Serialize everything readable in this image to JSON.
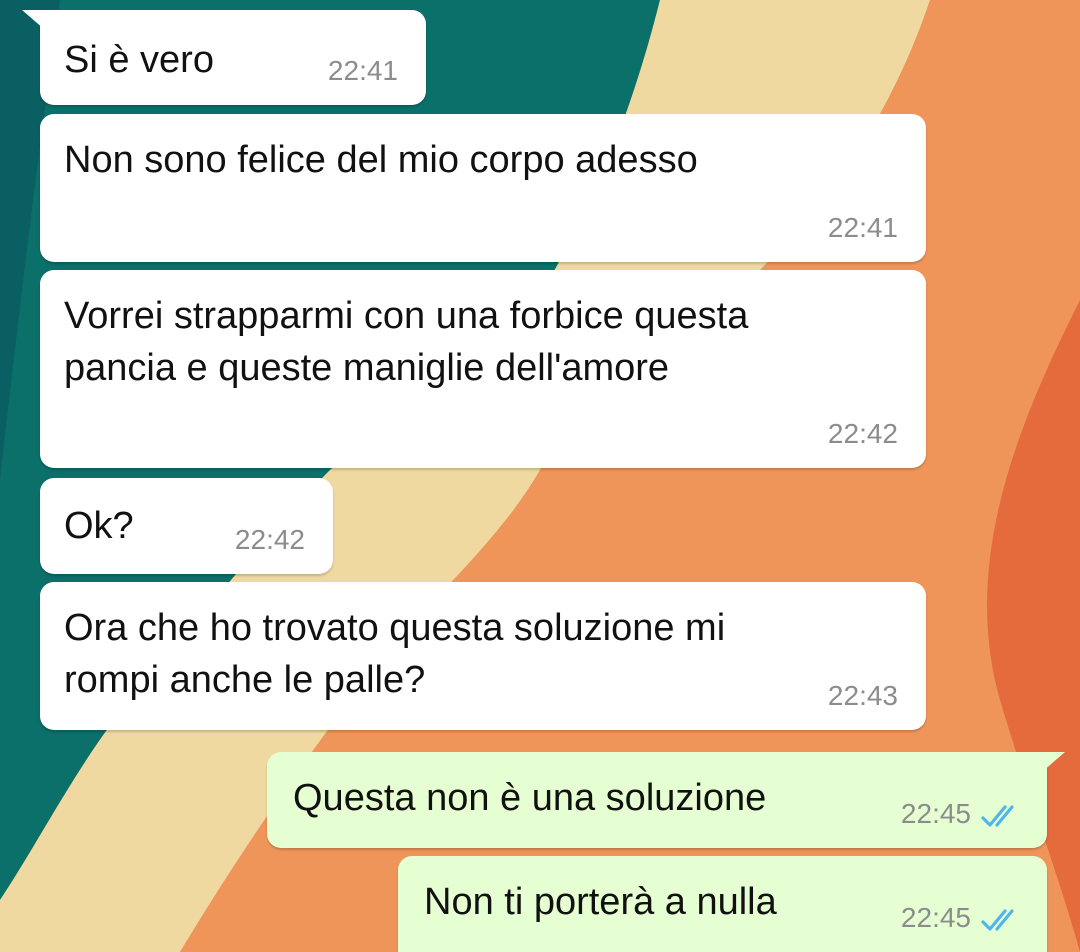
{
  "chat": {
    "messages": [
      {
        "direction": "incoming",
        "text": "Si è vero",
        "time": "22:41"
      },
      {
        "direction": "incoming",
        "text": "Non sono felice del mio corpo adesso",
        "time": "22:41"
      },
      {
        "direction": "incoming",
        "text": "Vorrei strapparmi con una forbice questa\npancia e queste maniglie dell'amore",
        "time": "22:42"
      },
      {
        "direction": "incoming",
        "text": "Ok?",
        "time": "22:42"
      },
      {
        "direction": "incoming",
        "text": "Ora che ho trovato questa soluzione mi\nrompi anche le palle?",
        "time": "22:43"
      },
      {
        "direction": "outgoing",
        "text": "Questa non è una soluzione",
        "time": "22:45",
        "status": "read",
        "status_icon": "double-check-icon"
      },
      {
        "direction": "outgoing",
        "text": "Non ti porterà a nulla",
        "time": "22:45",
        "status": "read",
        "status_icon": "double-check-icon"
      }
    ]
  },
  "colors": {
    "incoming_bubble": "#ffffff",
    "outgoing_bubble": "#e6ffd2",
    "read_ticks": "#4fb6ec",
    "timestamp": "#8c8c8c",
    "wallpaper_teal": "#0b6f6a",
    "wallpaper_cream": "#f0d9a0",
    "wallpaper_orange": "#f08a45"
  }
}
